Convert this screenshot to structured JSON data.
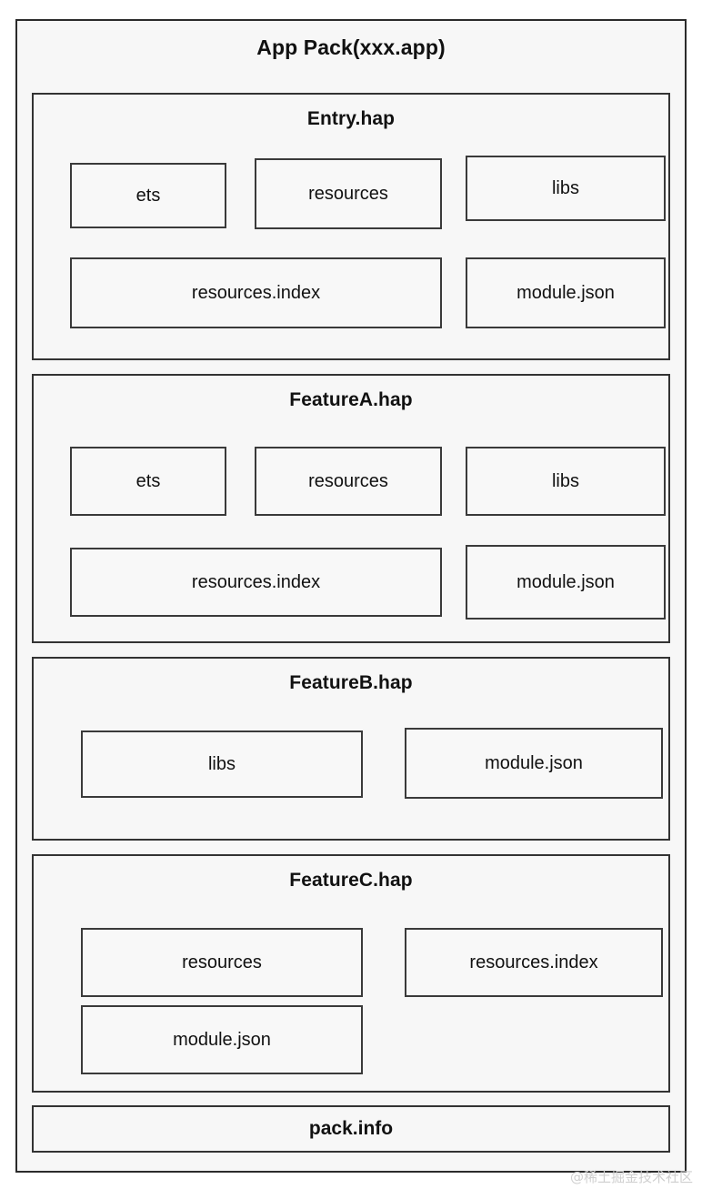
{
  "diagram": {
    "title": "App Pack(xxx.app)",
    "watermark": "@稀土掘金技术社区",
    "pack_info": {
      "label": "pack.info"
    },
    "sections": [
      {
        "id": "entry",
        "title": "Entry.hap",
        "items": [
          {
            "label": "ets"
          },
          {
            "label": "resources"
          },
          {
            "label": "libs"
          },
          {
            "label": "resources.index"
          },
          {
            "label": "module.json"
          }
        ]
      },
      {
        "id": "featurea",
        "title": "FeatureA.hap",
        "items": [
          {
            "label": "ets"
          },
          {
            "label": "resources"
          },
          {
            "label": "libs"
          },
          {
            "label": "resources.index"
          },
          {
            "label": "module.json"
          }
        ]
      },
      {
        "id": "featureb",
        "title": "FeatureB.hap",
        "items": [
          {
            "label": "libs"
          },
          {
            "label": "module.json"
          }
        ]
      },
      {
        "id": "featurec",
        "title": "FeatureC.hap",
        "items": [
          {
            "label": "resources"
          },
          {
            "label": "resources.index"
          },
          {
            "label": "module.json"
          }
        ]
      }
    ]
  },
  "colors": {
    "border": "#333333",
    "background": "#f7f7f7",
    "text": "#111111",
    "watermark": "#cfcfcf"
  }
}
